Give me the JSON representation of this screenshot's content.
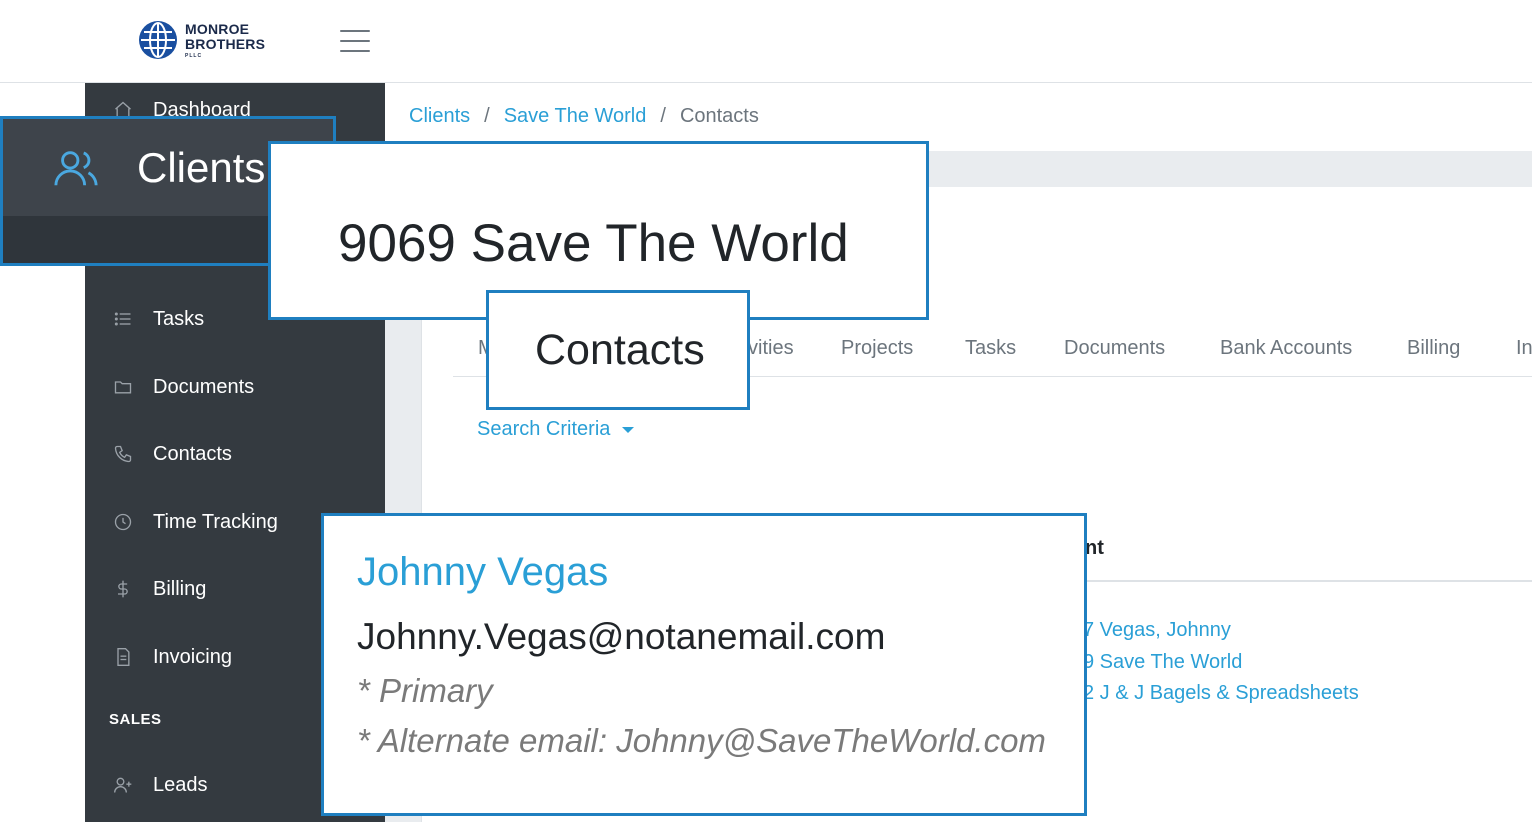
{
  "brand": {
    "line1": "MONROE",
    "line2": "BROTHERS",
    "line3": "PLLC"
  },
  "sidebar": {
    "items": [
      {
        "label": "Dashboard",
        "icon": "home-icon"
      },
      {
        "label": "Clients",
        "icon": "users-icon"
      },
      {
        "label": "Tasks",
        "icon": "list-icon"
      },
      {
        "label": "Documents",
        "icon": "folder-icon"
      },
      {
        "label": "Contacts",
        "icon": "phone-icon"
      },
      {
        "label": "Time Tracking",
        "icon": "clock-icon"
      },
      {
        "label": "Billing",
        "icon": "dollar-icon"
      },
      {
        "label": "Invoicing",
        "icon": "file-icon"
      },
      {
        "label": "Leads",
        "icon": "user-plus-icon"
      }
    ],
    "section_sales": "SALES"
  },
  "breadcrumb": {
    "item1": "Clients",
    "item2": "Save The World",
    "current": "Contacts",
    "separator": "/"
  },
  "page": {
    "client_title": "9069 Save The World"
  },
  "tabs": [
    {
      "label": "M"
    },
    {
      "label": "vities"
    },
    {
      "label": "Projects"
    },
    {
      "label": "Tasks"
    },
    {
      "label": "Documents"
    },
    {
      "label": "Bank Accounts"
    },
    {
      "label": "Billing"
    },
    {
      "label": "In"
    }
  ],
  "active_tab": "Contacts",
  "search": {
    "label": "Search Criteria"
  },
  "table": {
    "column_fragment": "nt",
    "client_links": [
      "7 Vegas, Johnny",
      "9 Save The World",
      "2 J & J Bagels & Spreadsheets"
    ]
  },
  "contact": {
    "name": "Johnny Vegas",
    "email": "Johnny.Vegas@notanemail.com",
    "note_primary": "* Primary",
    "note_alternate": "* Alternate email: Johnny@SaveTheWorld.com"
  },
  "colors": {
    "accent": "#2a9fd6",
    "callout_border": "#1f7fc0",
    "sidebar": "#343a40"
  }
}
